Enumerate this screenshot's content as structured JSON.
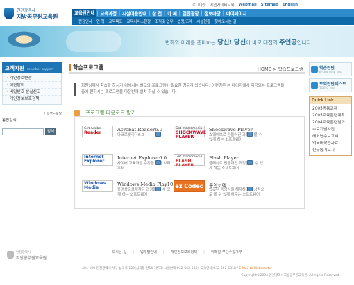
{
  "header": {
    "logo_sub": "인천광역시",
    "logo_main": "지방공무원교육원",
    "utility": [
      "로그아웃",
      "시민사이버교육",
      "Webmail",
      "Sitemap",
      "English"
    ],
    "main_nav": [
      "교육원안내",
      "교육과정",
      "시설이용안내",
      "참 전",
      "카 페",
      "열린광장",
      "정보마당",
      "마이페이지"
    ],
    "sub_nav": [
      "원장인사",
      "연 혁",
      "교육목표",
      "교육서비스헌장",
      "조직및 업무",
      "법령/조례",
      "시설현황",
      "찾아오시는 길"
    ],
    "slogan_a": "변화",
    "slogan_b": "와 미래를 준비하는",
    "slogan_c": "당신!",
    "slogan_d": "당신",
    "slogan_e": "이 바로 대접의",
    "slogan_f": "주인공",
    "slogan_g": "입니다"
  },
  "sidebar": {
    "title": "고객지원",
    "title_en": "member support",
    "items": [
      "개인정보변경",
      "회원탈퇴",
      "비밀번호 분실신고",
      "개인정보보호정책"
    ]
  },
  "search": {
    "label": "통합검색",
    "option": "/ 검색도움말",
    "button": "검색"
  },
  "content": {
    "title": "학습프로그램",
    "breadcrumb": "HOME > 학습프로그램",
    "intro": [
      "회원님께서 학습을 하시기 위해서는 별도의 프로그램이 필요한 경우가 있습니다. 이런경우 본 페이지에서 제공되는 프로그램들",
      "중에 원하시는 프로그램을 다운받아 설치 하실 수 있습니다."
    ],
    "download_title": "프로그램 다운로드 받기",
    "downloads": [
      {
        "logo_top": "Get Adobe",
        "logo_big": "Reader",
        "name": "Acrobat Reader6.0",
        "desc": "아크로뱃리더6.0"
      },
      {
        "logo_top": "Get macromedia",
        "logo_big": "SHOCKWAVE PLAYER",
        "name": "Shockwave Player",
        "desc": "쇼웨이브로 만들어진 과정을 볼 수 있게 하는 소프트웨어"
      },
      {
        "logo_top": "",
        "logo_big": "Internet Explorer",
        "name": "Internet Explorer6.0",
        "desc": "사이버 교육과정 수강을 위한 브라우저"
      },
      {
        "logo_top": "Get macromedia",
        "logo_big": "FLASH PLAYER",
        "name": "Flash Player",
        "desc": "플래쉬로 만들어진 과정을 볼 수 있게 하는 소프트웨어"
      },
      {
        "logo_top": "",
        "logo_big": "Windows Media",
        "name": "Windows Media Play10",
        "desc": "동영상으로제작된 과정을 볼 수 있게 하는 소프트웨어"
      },
      {
        "logo_top": "",
        "logo_big": "ez Codec",
        "name": "통합코덱",
        "desc": "압축된 동영상을 해제하여 정상적으로 볼 수 있게 해주는 소프트웨어"
      }
    ]
  },
  "right": {
    "banner1_title": "학습진단",
    "banner1_sub": "E-Learning test",
    "banner2_title": "토익진단테스트",
    "banner2_sub": "TOEIC test",
    "quick_head": "Quick Link",
    "quick_links": [
      "2005공통교재",
      "2005교육훈련계획",
      "2004교육훈련결과",
      "수료기념사진",
      "해외연수보고서",
      "외국어학습자료",
      "신규통기교지"
    ]
  },
  "footer": {
    "links": [
      "오시는 길",
      "업무별안내",
      "개인정보보호정책",
      "이메일 무단수집거부"
    ],
    "logo_sub": "인천광역시",
    "logo_main": "지방공무원교육원",
    "address": "404-190 인천광역시 서구 심곡로 128(심곡동 산54-1번지) 시설안내:032-562-5854  교육안내:032-562-5818 /",
    "mail": "E-Mail to Webmaster",
    "copyright": "Copyright©2004 인천광역시지방공무원교육원. All rights Reserved."
  },
  "colors": {
    "nav_blue": "#2e8ccc",
    "subnav_blue": "#0f6aa9",
    "accent_orange": "#e07a2a",
    "download_green": "#4c8e3c"
  }
}
